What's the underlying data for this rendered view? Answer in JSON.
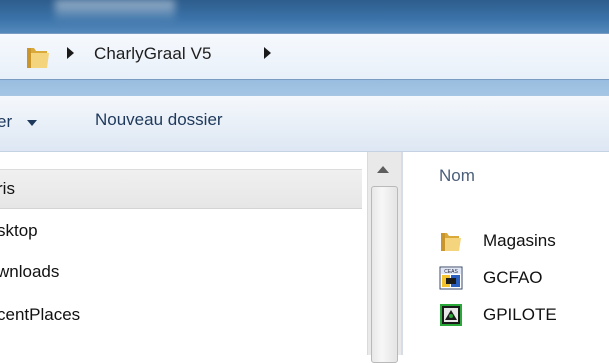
{
  "address_bar": {
    "crumbs": [
      "CharlyGraal V5"
    ]
  },
  "toolbar": {
    "organize_label": "er",
    "new_folder_label": "Nouveau dossier"
  },
  "nav_pane": {
    "items": [
      "ris",
      "sktop",
      "wnloads",
      "centPlaces"
    ]
  },
  "file_list": {
    "column_header": "Nom",
    "items": [
      {
        "name": "Magasins",
        "icon": "folder-icon"
      },
      {
        "name": "GCFAO",
        "icon": "gcfao-app-icon"
      },
      {
        "name": "GPILOTE",
        "icon": "gpilote-app-icon"
      }
    ]
  },
  "colors": {
    "title_gradient_top": "#2e5d8c",
    "folder_yellow": "#e9c46a",
    "toolbar_text": "#1e395b"
  }
}
